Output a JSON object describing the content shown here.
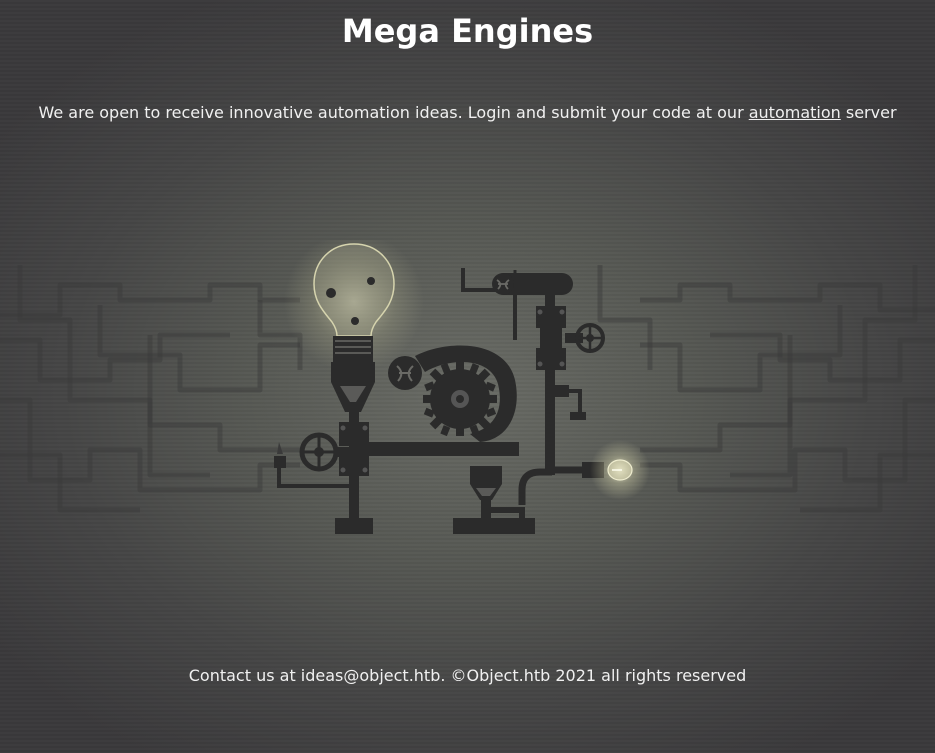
{
  "header": {
    "title": "Mega Engines"
  },
  "intro": {
    "text_before": "We are open to receive innovative automation ideas. Login and submit your code at our ",
    "link_label": "automation",
    "text_after": " server"
  },
  "footer": {
    "text": "Contact us at ideas@object.htb. ©Object.htb 2021 all rights reserved"
  },
  "illustration": {
    "icon": "steam-machine-illustration"
  },
  "colors": {
    "text": "#ffffff",
    "background_center": "#6a6c66",
    "background_edge": "#3b3a3c",
    "machine": "#2b2b2b",
    "bulb_glow": "#e8e6c0"
  }
}
